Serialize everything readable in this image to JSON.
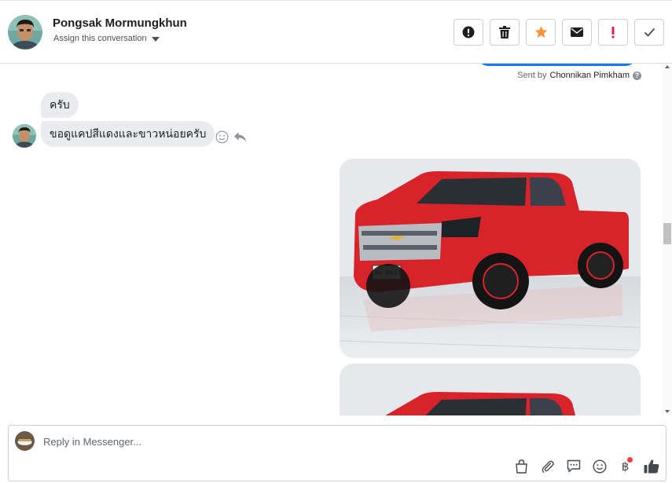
{
  "header": {
    "contact_name": "Pongsak Mormungkhun",
    "assign_label": "Assign this conversation",
    "actions": [
      {
        "name": "spam-button",
        "icon": "exclamation-circle-icon"
      },
      {
        "name": "delete-button",
        "icon": "trash-icon"
      },
      {
        "name": "star-button",
        "icon": "star-icon"
      },
      {
        "name": "mark-unread-button",
        "icon": "envelope-icon"
      },
      {
        "name": "follow-up-button",
        "icon": "exclamation-icon"
      },
      {
        "name": "mark-done-button",
        "icon": "checkmark-icon"
      }
    ]
  },
  "thread": {
    "sent_by_prefix": "Sent by",
    "sent_by_name": "Chonnikan Pimkham",
    "messages": [
      {
        "text": "ครับ"
      },
      {
        "text": "ขอดูแคปสีแดงและขาวหน่อยครับ"
      }
    ]
  },
  "composer": {
    "placeholder": "Reply in Messenger...",
    "tools": [
      "shopping-bag-icon",
      "paperclip-icon",
      "saved-reply-icon",
      "emoji-icon",
      "baht-payment-icon",
      "thumbs-up-icon"
    ],
    "baht_symbol": "฿"
  },
  "colors": {
    "accent": "#1877f2",
    "star": "#f7923a",
    "follow_up": "#e41e3f",
    "car_red": "#d8232a",
    "badge": "#fa3e3e"
  }
}
